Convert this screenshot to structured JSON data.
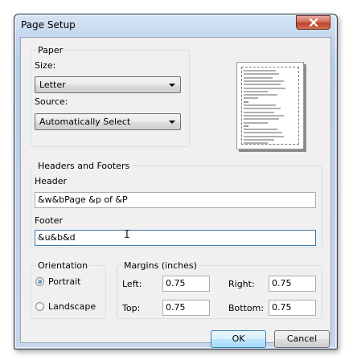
{
  "window": {
    "title": "Page Setup"
  },
  "paper": {
    "group_title": "Paper",
    "size_label": "Size:",
    "size_value": "Letter",
    "source_label": "Source:",
    "source_value": "Automatically Select"
  },
  "headers_footers": {
    "group_title": "Headers and Footers",
    "header_label": "Header",
    "header_value": "&w&bPage &p of &P",
    "footer_label": "Footer",
    "footer_value": "&u&b&d"
  },
  "orientation": {
    "group_title": "Orientation",
    "portrait_label": "Portrait",
    "landscape_label": "Landscape",
    "selected": "Portrait"
  },
  "margins": {
    "group_title": "Margins (inches)",
    "left_label": "Left:",
    "left_value": "0.75",
    "right_label": "Right:",
    "right_value": "0.75",
    "top_label": "Top:",
    "top_value": "0.75",
    "bottom_label": "Bottom:",
    "bottom_value": "0.75"
  },
  "buttons": {
    "ok": "OK",
    "cancel": "Cancel"
  },
  "icons": {
    "close": "close-icon",
    "preview": "page-preview-icon"
  },
  "colors": {
    "close_red": "#c0412c",
    "focus_blue": "#3d7bad",
    "frame_blue": "#c4d7ee"
  }
}
